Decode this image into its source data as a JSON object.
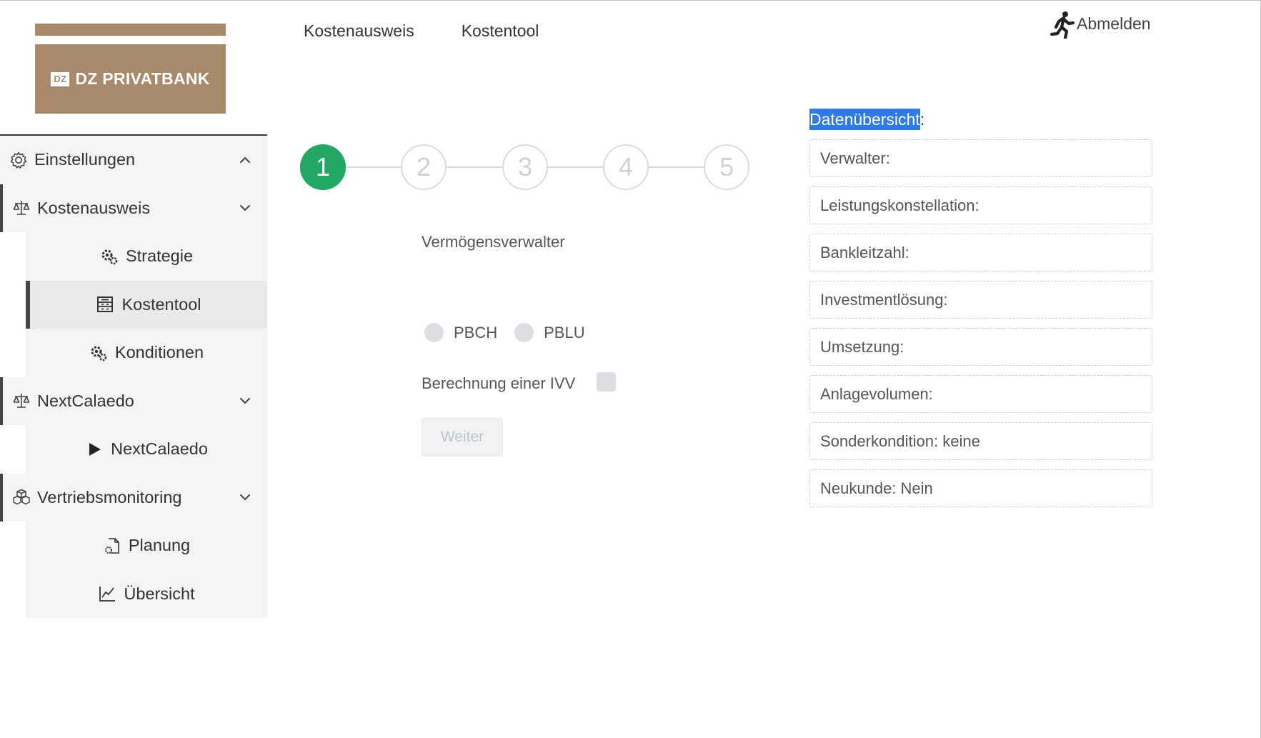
{
  "brand": {
    "name": "DZ PRIVATBANK",
    "mark": "DZ",
    "color": "#a8896a"
  },
  "topnav": {
    "items": [
      "Kostenausweis",
      "Kostentool"
    ],
    "logout": "Abmelden"
  },
  "sidebar": {
    "groups": [
      {
        "label": "Einstellungen",
        "icon": "gear-icon",
        "expanded": true
      },
      {
        "label": "Kostenausweis",
        "icon": "scale-icon",
        "expanded": false,
        "children": [
          {
            "label": "Strategie",
            "icon": "gears-icon"
          },
          {
            "label": "Kostentool",
            "icon": "calculator-icon",
            "active": true
          },
          {
            "label": "Konditionen",
            "icon": "gears-icon"
          }
        ]
      },
      {
        "label": "NextCalaedo",
        "icon": "scale-icon",
        "expanded": false,
        "children": [
          {
            "label": "NextCalaedo",
            "icon": "play-icon"
          }
        ]
      },
      {
        "label": "Vertriebsmonitoring",
        "icon": "boxes-icon",
        "expanded": false,
        "children": [
          {
            "label": "Planung",
            "icon": "file-gear-icon"
          },
          {
            "label": "Übersicht",
            "icon": "line-chart-icon"
          }
        ]
      }
    ]
  },
  "stepper": {
    "steps": [
      "1",
      "2",
      "3",
      "4",
      "5"
    ],
    "active": 1,
    "active_color": "#24a764"
  },
  "form": {
    "label": "Vermögensverwalter",
    "radios": [
      "PBCH",
      "PBLU"
    ],
    "ivv_label": "Berechnung einer IVV",
    "submit": "Weiter"
  },
  "overview": {
    "title_highlight": "Datenübersicht",
    "title_suffix": ":",
    "fields": [
      "Verwalter:",
      "Leistungskonstellation:",
      "Bankleitzahl:",
      "Investmentlösung:",
      "Umsetzung:",
      "Anlagevolumen:",
      "Sonderkondition: keine",
      "Neukunde: Nein"
    ]
  }
}
